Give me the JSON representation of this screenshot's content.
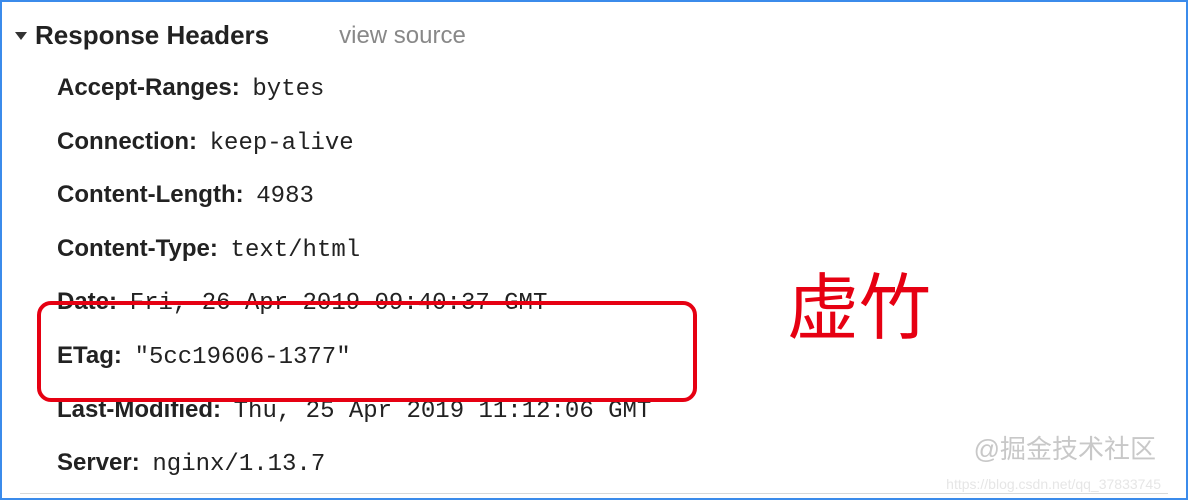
{
  "section": {
    "title": "Response Headers",
    "view_source": "view source"
  },
  "headers": [
    {
      "name": "Accept-Ranges:",
      "value": "bytes"
    },
    {
      "name": "Connection:",
      "value": "keep-alive"
    },
    {
      "name": "Content-Length:",
      "value": "4983"
    },
    {
      "name": "Content-Type:",
      "value": "text/html"
    },
    {
      "name": "Date:",
      "value": "Fri, 26 Apr 2019 09:40:37 GMT"
    },
    {
      "name": "ETag:",
      "value": "\"5cc19606-1377\""
    },
    {
      "name": "Last-Modified:",
      "value": "Thu, 25 Apr 2019 11:12:06 GMT"
    },
    {
      "name": "Server:",
      "value": "nginx/1.13.7"
    }
  ],
  "annotation": "虚竹",
  "watermark1": "@掘金技术社区",
  "watermark2": "https://blog.csdn.net/qq_37833745"
}
